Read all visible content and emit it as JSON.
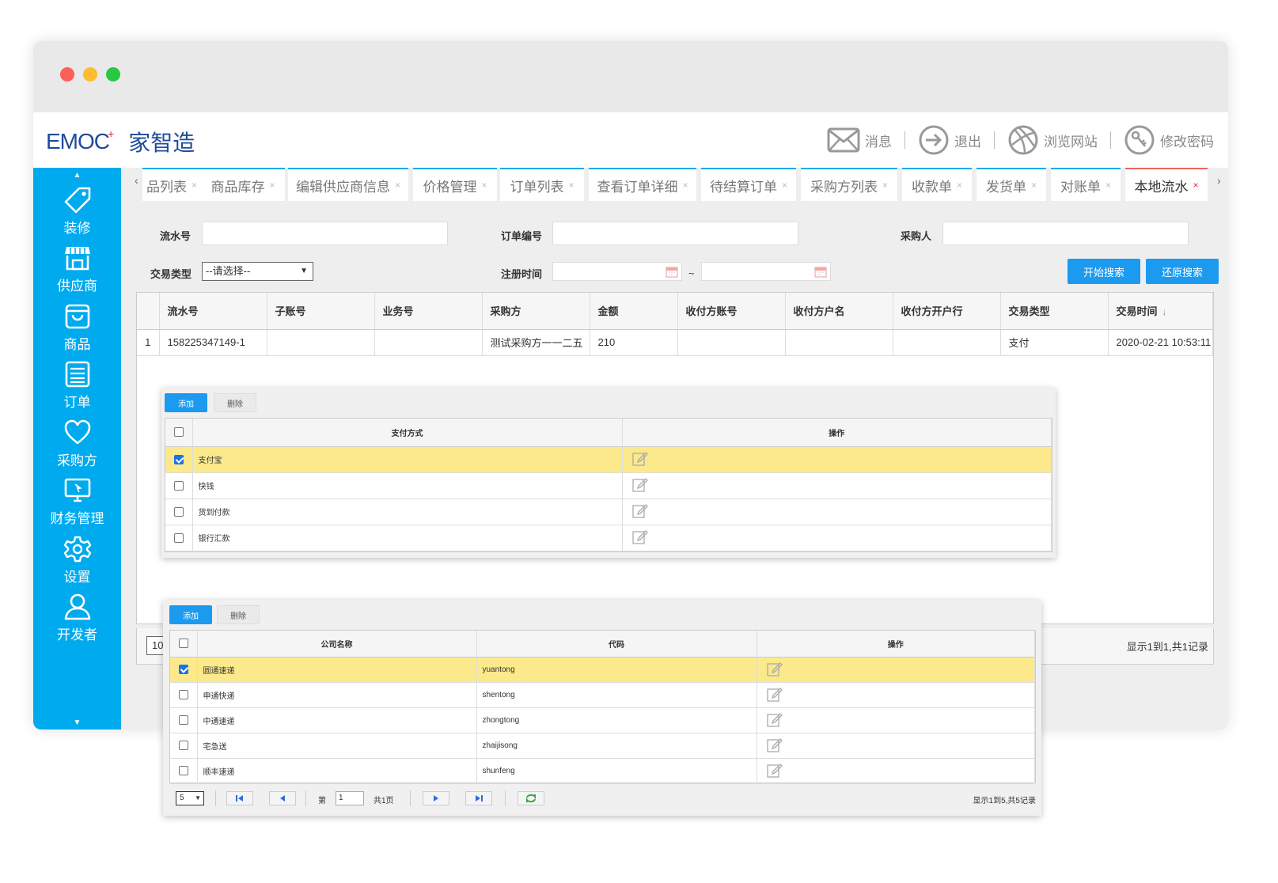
{
  "window": {
    "controls": [
      "close",
      "minimize",
      "maximize"
    ]
  },
  "header": {
    "logo_en": "EMOC",
    "logo_cn": "家智造",
    "links": [
      {
        "label": "消息",
        "icon": "envelope-icon"
      },
      {
        "label": "退出",
        "icon": "logout-arrow-icon"
      },
      {
        "label": "浏览网站",
        "icon": "globe-ball-icon"
      },
      {
        "label": "修改密码",
        "icon": "key-icon"
      }
    ]
  },
  "sidebar": {
    "items": [
      {
        "label": "装修",
        "icon": "tag-icon"
      },
      {
        "label": "供应商",
        "icon": "store-icon"
      },
      {
        "label": "商品",
        "icon": "bag-icon"
      },
      {
        "label": "订单",
        "icon": "list-icon"
      },
      {
        "label": "采购方",
        "icon": "heart-icon"
      },
      {
        "label": "财务管理",
        "icon": "monitor-icon"
      },
      {
        "label": "设置",
        "icon": "gear-icon"
      },
      {
        "label": "开发者",
        "icon": "user-icon"
      }
    ]
  },
  "tabs": [
    {
      "label": "品列表"
    },
    {
      "label": "商品库存"
    },
    {
      "label": "编辑供应商信息"
    },
    {
      "label": "价格管理"
    },
    {
      "label": "订单列表"
    },
    {
      "label": "查看订单详细"
    },
    {
      "label": "待结算订单"
    },
    {
      "label": "采购方列表"
    },
    {
      "label": "收款单"
    },
    {
      "label": "发货单"
    },
    {
      "label": "对账单"
    },
    {
      "label": "本地流水",
      "active": true
    }
  ],
  "search": {
    "serial_label": "流水号",
    "order_label": "订单编号",
    "buyer_label": "采购人",
    "type_label": "交易类型",
    "type_value": "--请选择--",
    "reg_time_label": "注册时间",
    "range_sep": "~",
    "search_button": "开始搜索",
    "reset_button": "还原搜索"
  },
  "main_table": {
    "columns": [
      "流水号",
      "子账号",
      "业务号",
      "采购方",
      "金额",
      "收付方账号",
      "收付方户名",
      "收付方开户行",
      "交易类型",
      "交易时间"
    ],
    "rows": [
      {
        "no": "1",
        "cells": [
          "158225347149-1",
          "",
          "",
          "测试采购方一一二五",
          "210",
          "",
          "",
          "",
          "支付",
          "2020-02-21 10:53:11"
        ]
      }
    ],
    "page_size": "10",
    "info": "显示1到1,共1记录"
  },
  "payment_panel": {
    "add_label": "添加",
    "delete_label": "删除",
    "columns": [
      "支付方式",
      "操作"
    ],
    "rows": [
      {
        "name": "支付宝",
        "checked": true
      },
      {
        "name": "快钱",
        "checked": false
      },
      {
        "name": "货到付款",
        "checked": false
      },
      {
        "name": "银行汇款",
        "checked": false
      }
    ]
  },
  "express_panel": {
    "add_label": "添加",
    "delete_label": "删除",
    "columns": [
      "公司名称",
      "代码",
      "操作"
    ],
    "rows": [
      {
        "name": "圆通速递",
        "code": "yuantong",
        "checked": true
      },
      {
        "name": "申通快递",
        "code": "shentong",
        "checked": false
      },
      {
        "name": "中通速递",
        "code": "zhongtong",
        "checked": false
      },
      {
        "name": "宅急送",
        "code": "zhaijisong",
        "checked": false
      },
      {
        "name": "顺丰速递",
        "code": "shunfeng",
        "checked": false
      }
    ],
    "pager": {
      "page_size": "5",
      "page_prefix": "第",
      "page_value": "1",
      "page_total": "共1页",
      "info": "显示1到5,共5记录"
    }
  },
  "colors": {
    "sidebar": "#00aaee",
    "button_blue": "#1b9af0",
    "selected_row": "#fbe98c",
    "logo": "#1e4b9c",
    "active_tab_close": "#e5263a"
  }
}
